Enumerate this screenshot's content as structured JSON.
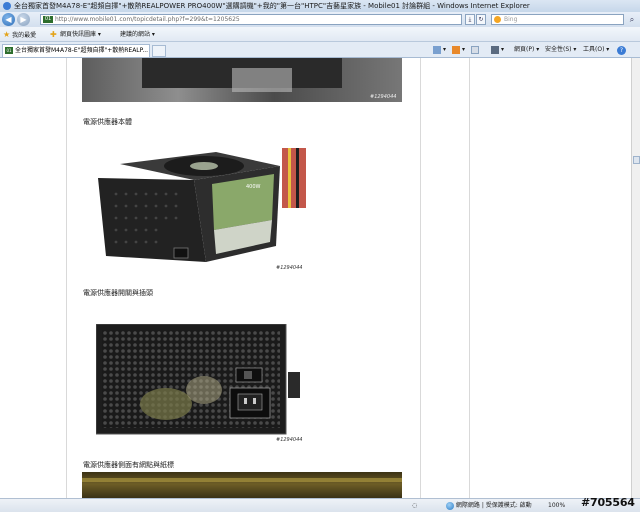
{
  "window": {
    "title": "全台獨家首發M4A78-E\"超頻自擇\"+散熱REALPOWER PRO400W\"選購調機\"+我的\"第一台\"HTPC\"吉藝星家族 - Mobile01 討論群組 - Windows Internet Explorer"
  },
  "address_bar": {
    "url": "http://www.mobile01.com/topicdetail.php?f=299&t=1205625",
    "site_icon_text": "01",
    "search_placeholder": "Bing"
  },
  "favorites_bar": {
    "favorites_label": "我的最愛",
    "suggested_sites_label": "建議的網站 ▾",
    "gallery_label": "網頁快訊圖庫 ▾"
  },
  "tab": {
    "title": "全台獨家首發M4A78-E\"超頻自擇\"+散熱REALP...",
    "site_icon_text": "01"
  },
  "command_bar": {
    "page_menu": "網頁(P) ▾",
    "safety_menu": "安全性(S) ▾",
    "tools_menu": "工具(O) ▾",
    "help_symbol": "?"
  },
  "content": {
    "captions": [
      "電源供應器本體",
      "電源供應器開關與插頭",
      "電源供應器側面有網點與紙標"
    ],
    "watermarks": [
      "#1294044",
      "#1294044",
      "#1294044"
    ],
    "psu_label_text": "400W"
  },
  "status_bar": {
    "zone_text": "網際網路 | 受保護模式: 啟動",
    "zoom_text": "100%"
  },
  "stamp": "#705564"
}
